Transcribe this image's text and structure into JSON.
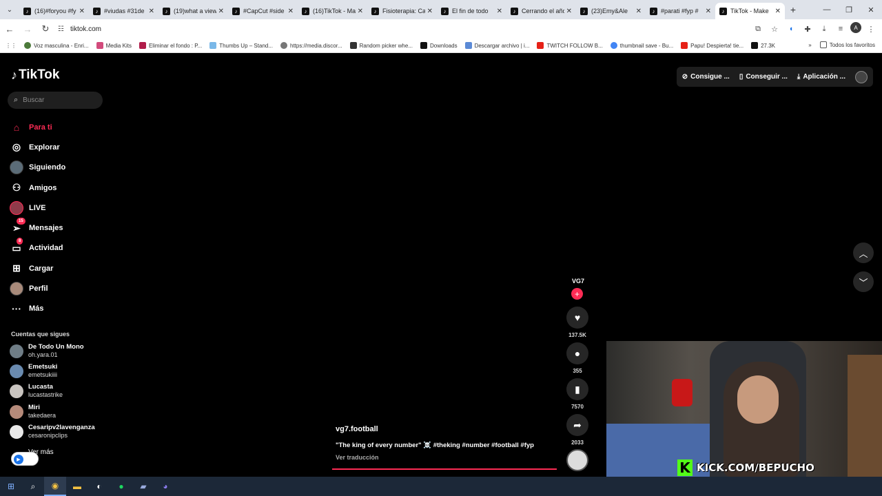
{
  "browser": {
    "tabs": [
      {
        "title": "(16)#foryou #fy",
        "active": false
      },
      {
        "title": "#viudas #31de",
        "active": false
      },
      {
        "title": "(19)what a view",
        "active": false
      },
      {
        "title": "#CapCut #side",
        "active": false
      },
      {
        "title": "(16)TikTok - Ma",
        "active": false
      },
      {
        "title": "Fisioterapia: Ca",
        "active": false
      },
      {
        "title": "El fin de todo",
        "active": false
      },
      {
        "title": "Cerrando el año",
        "active": false
      },
      {
        "title": "(23)Emy&Ale",
        "active": false
      },
      {
        "title": "#parati #fyp #",
        "active": false
      },
      {
        "title": "TikTok - Make",
        "active": true
      }
    ],
    "url": "tiktok.com",
    "profile_initial": "A",
    "bookmarks": [
      "Voz masculina - Enri...",
      "Media Kits",
      "Eliminar el fondo : P...",
      "Thumbs Up – Stand...",
      "https://media.discor...",
      "Random picker whe...",
      "Downloads",
      "Descargar archivo | i...",
      "TWITCH FOLLOW B...",
      "thumbnail save - Bu...",
      "Papu! Despierta! tie...",
      "27.3K"
    ],
    "all_bookmarks": "Todos los favoritos"
  },
  "tiktok": {
    "logo": "TikTok",
    "search_placeholder": "Buscar",
    "nav": [
      {
        "label": "Para ti",
        "icon": "home-icon",
        "active": true
      },
      {
        "label": "Explorar",
        "icon": "compass-icon"
      },
      {
        "label": "Siguiendo",
        "icon": "avatar-icon"
      },
      {
        "label": "Amigos",
        "icon": "friends-icon"
      },
      {
        "label": "LIVE",
        "icon": "live-avatar-icon"
      },
      {
        "label": "Mensajes",
        "icon": "send-icon",
        "badge": "15"
      },
      {
        "label": "Actividad",
        "icon": "activity-icon",
        "badge": "8"
      },
      {
        "label": "Cargar",
        "icon": "upload-icon"
      },
      {
        "label": "Perfil",
        "icon": "profile-avatar-icon"
      },
      {
        "label": "Más",
        "icon": "more-icon"
      }
    ],
    "following_title": "Cuentas que sigues",
    "accounts": [
      {
        "name": "De Todo Un Mono",
        "handle": "oh.yara.01"
      },
      {
        "name": "Emetsuki",
        "handle": "emetsukiiii"
      },
      {
        "name": "Lucasta",
        "handle": "lucastastrike"
      },
      {
        "name": "Miri",
        "handle": "takedaera"
      },
      {
        "name": "Cesaripv2lavenganza",
        "handle": "cesaronipclips"
      }
    ],
    "see_more": "Ver más",
    "top_buttons": [
      "Consigue ...",
      "Conseguir ...",
      "Aplicación ..."
    ],
    "video": {
      "creator_logo": "VG7",
      "likes": "137.5K",
      "comments": "355",
      "saves": "7570",
      "shares": "2033",
      "username": "vg7.football",
      "caption": "\"The king of every number\" ☠️ #theking #number #football #fyp",
      "translate": "Ver traducción"
    }
  },
  "stream_overlay": {
    "kick_text": "KICK.COM/BEPUCHO"
  }
}
